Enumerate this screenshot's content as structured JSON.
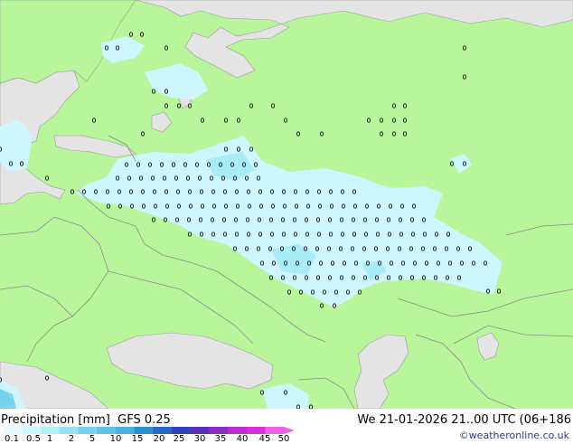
{
  "footer": {
    "title": "Precipitation [mm]",
    "model": "GFS 0.25",
    "datetime": "We 21-01-2026 21..00 UTC (06+186",
    "credit": "©weatheronline.co.uk"
  },
  "legend": {
    "labels": [
      "0.1",
      "0.5",
      "1",
      "2",
      "5",
      "10",
      "15",
      "20",
      "25",
      "30",
      "35",
      "40",
      "45",
      "50"
    ],
    "colors": [
      "#e4fbff",
      "#cdf6ff",
      "#b1eef9",
      "#95e2f4",
      "#7ad3ee",
      "#5fc3e6",
      "#45b1dc",
      "#2d8fd0",
      "#2a66c6",
      "#2f42b8",
      "#5a2fb8",
      "#8a2fc0",
      "#b52fc8",
      "#d82fd8",
      "#ef5fe8"
    ]
  },
  "map_colors": {
    "land": "#b9f59a",
    "sea": "#e4e4e4",
    "precip_light": "#cdf6ff",
    "precip_medium": "#a8ecf7",
    "precip_heavy": "#7ad3ee",
    "border": "#8a8a8a"
  },
  "precip_marker": "o"
}
